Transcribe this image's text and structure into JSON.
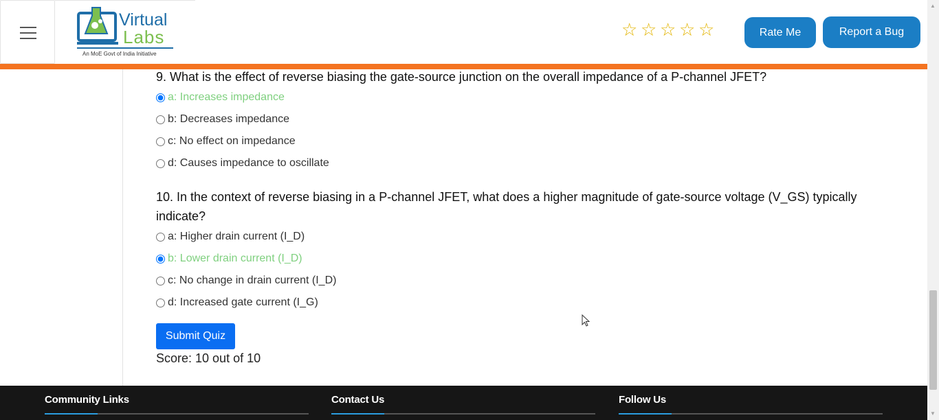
{
  "header": {
    "logo_title": "Virtual",
    "logo_sub_title": "Labs",
    "logo_tagline": "An MoE Govt of India Initiative",
    "stars": [
      "☆",
      "☆",
      "☆",
      "☆",
      "☆"
    ],
    "rate_label": "Rate Me",
    "bug_label": "Report a Bug"
  },
  "quiz": {
    "q9": {
      "text": "9. What is the effect of reverse biasing the gate-source junction on the overall impedance of a P-channel JFET?",
      "options": [
        {
          "label": "a: Increases impedance",
          "checked": true,
          "correct": true
        },
        {
          "label": "b: Decreases impedance",
          "checked": false,
          "correct": false
        },
        {
          "label": "c: No effect on impedance",
          "checked": false,
          "correct": false
        },
        {
          "label": "d: Causes impedance to oscillate",
          "checked": false,
          "correct": false
        }
      ]
    },
    "q10": {
      "text": "10. In the context of reverse biasing in a P-channel JFET, what does a higher magnitude of gate-source voltage (V_GS) typically indicate?",
      "options": [
        {
          "label": "a: Higher drain current (I_D)",
          "checked": false,
          "correct": false
        },
        {
          "label": "b: Lower drain current (I_D)",
          "checked": true,
          "correct": true
        },
        {
          "label": "c: No change in drain current (I_D)",
          "checked": false,
          "correct": false
        },
        {
          "label": "d: Increased gate current (I_G)",
          "checked": false,
          "correct": false
        }
      ]
    },
    "submit_label": "Submit Quiz",
    "score_text": "Score: 10 out of 10"
  },
  "footer": {
    "col1": "Community Links",
    "col2": "Contact Us",
    "col3": "Follow Us"
  },
  "colors": {
    "accent_orange": "#f47320",
    "button_blue": "#1b7ec5",
    "submit_blue": "#0a6ef2",
    "correct_green": "#7fd07f"
  }
}
